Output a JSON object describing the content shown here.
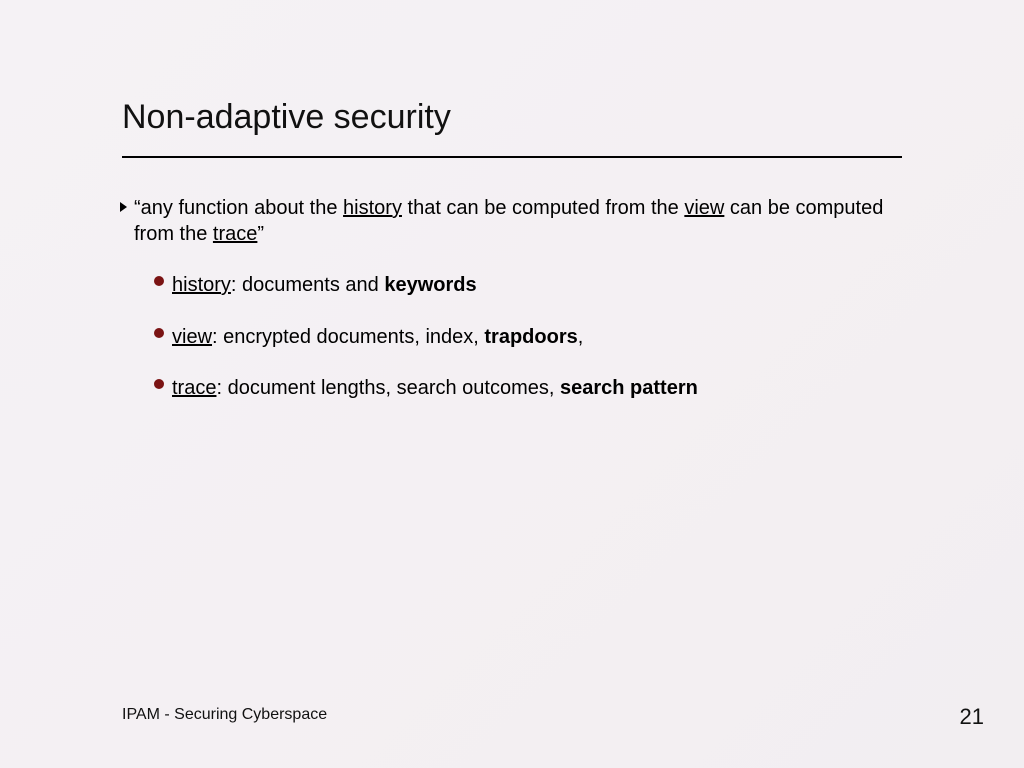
{
  "title": "Non-adaptive security",
  "main_point": {
    "pre1": "“any function about the ",
    "u1": "history",
    "mid1": " that can be computed from the ",
    "u2": "view",
    "mid2": " can be computed from the ",
    "u3": "trace",
    "post": "”"
  },
  "sub1": {
    "u": "history",
    "rest1": ": documents and ",
    "bold": "keywords"
  },
  "sub2": {
    "u": "view",
    "rest1": ": encrypted documents, index, ",
    "bold": "trapdoors",
    "rest2": ","
  },
  "sub3": {
    "u": "trace",
    "rest1": ": document lengths, search outcomes, ",
    "bold": "search pattern"
  },
  "footer": "IPAM - Securing Cyberspace",
  "page": "21"
}
